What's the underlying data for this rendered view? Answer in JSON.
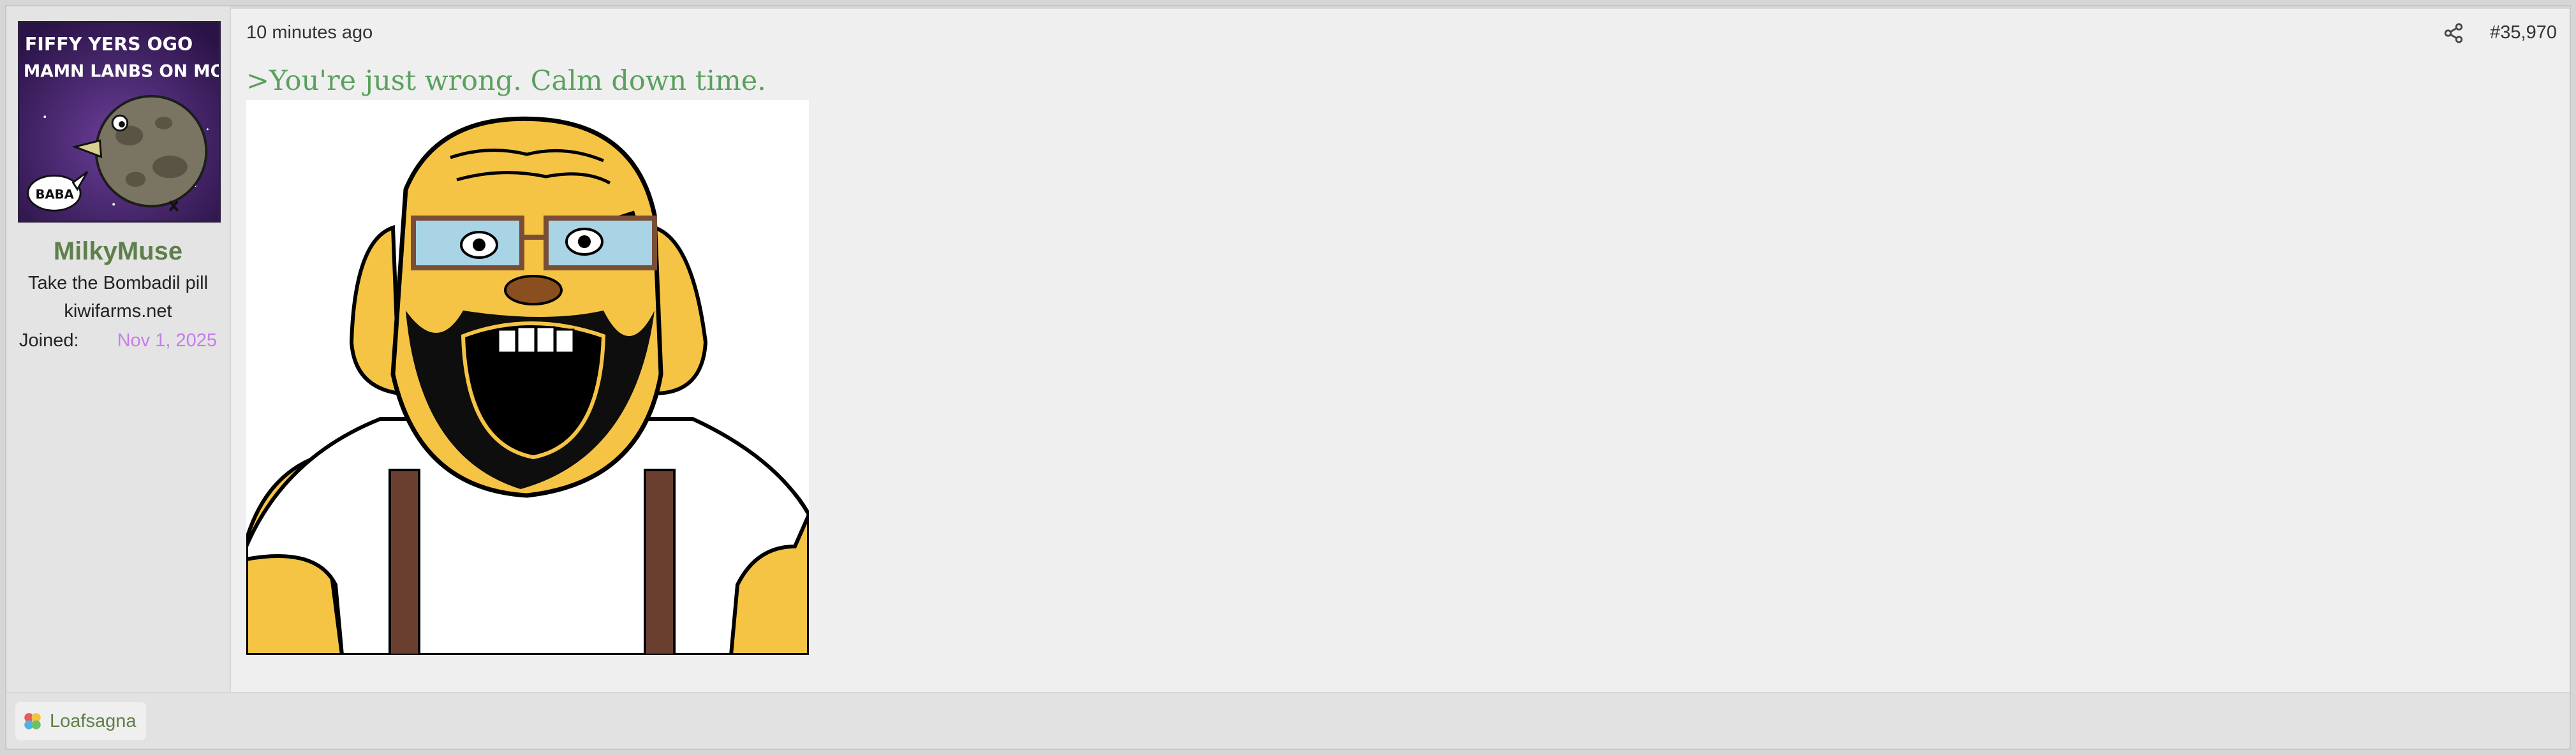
{
  "user": {
    "username": "MilkyMuse",
    "title": "Take the Bombadil pill",
    "extra": "kiwifarms.net",
    "joined_label": "Joined:",
    "joined_value": "Nov 1, 2025",
    "avatar_text": {
      "line1": "FIFFY YERS OGO",
      "line2": "MAMN LANBS ON MOO",
      "bubble": "BABA"
    }
  },
  "post": {
    "timestamp": "10 minutes ago",
    "number": "#35,970",
    "greentext": ">You're just wrong. Calm down time."
  },
  "reactions": {
    "user": "Loafsagna"
  },
  "icons": {
    "share": "share-icon",
    "reaction": "reaction-icon"
  },
  "colors": {
    "username": "#5f7f4a",
    "greentext": "#5aa15d",
    "joined_date": "#c77ee8",
    "reaction_link": "#5f7f4a"
  }
}
